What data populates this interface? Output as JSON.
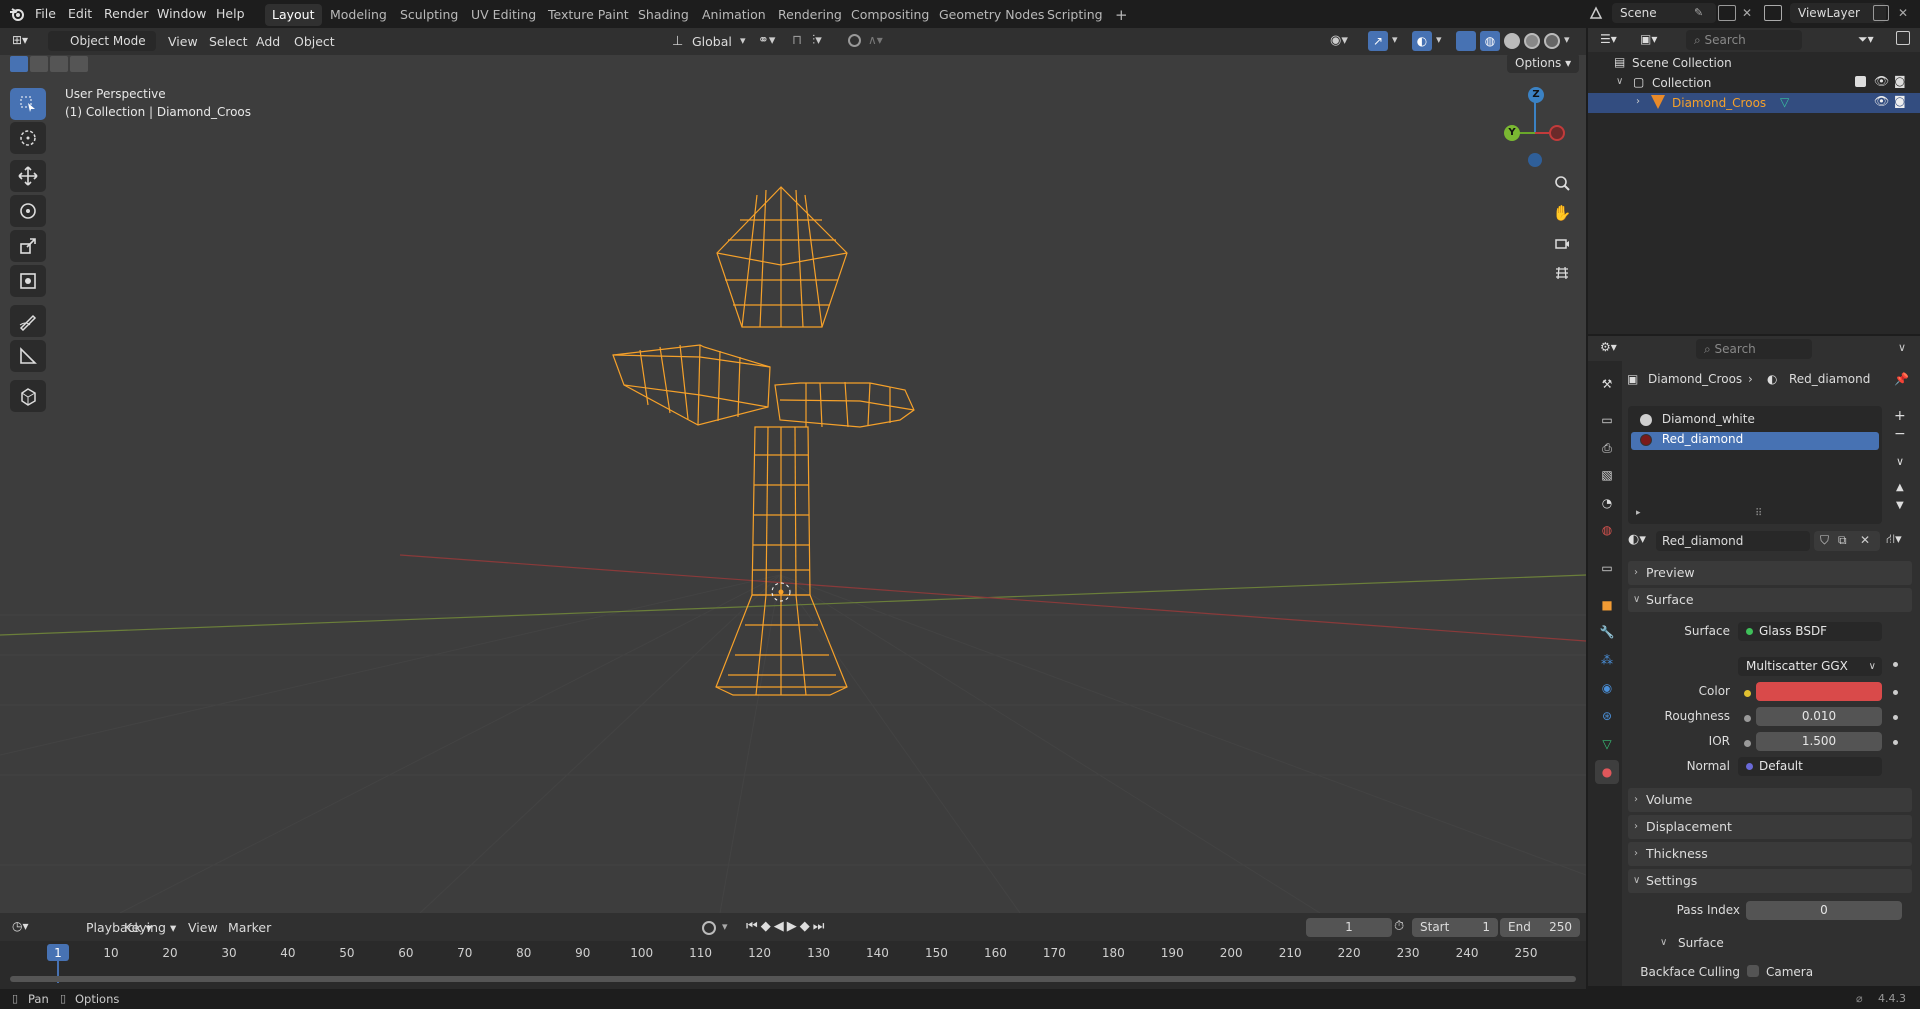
{
  "topbar": {
    "menus": [
      "File",
      "Edit",
      "Render",
      "Window",
      "Help"
    ],
    "workspaces": [
      "Layout",
      "Modeling",
      "Sculpting",
      "UV Editing",
      "Texture Paint",
      "Shading",
      "Animation",
      "Rendering",
      "Compositing",
      "Geometry Nodes",
      "Scripting"
    ],
    "active_workspace": "Layout",
    "scene_name": "Scene",
    "viewlayer_name": "ViewLayer"
  },
  "viewport_header": {
    "mode": "Object Mode",
    "menus": [
      "View",
      "Select",
      "Add",
      "Object"
    ],
    "orientation": "Global",
    "options_label": "Options"
  },
  "viewport": {
    "perspective": "User Perspective",
    "context": "(1) Collection | Diamond_Croos",
    "gizmo_axes": {
      "z": "Z",
      "y": "Y"
    },
    "wire_color": "#f6a12a",
    "bg_color": "#3d3d3d"
  },
  "outliner": {
    "search_placeholder": "Search",
    "root": "Scene Collection",
    "collection": "Collection",
    "object": "Diamond_Croos"
  },
  "properties": {
    "search_placeholder": "Search",
    "breadcrumb_object": "Diamond_Croos",
    "breadcrumb_material": "Red_diamond",
    "material_slots": [
      {
        "name": "Diamond_white",
        "color": "#cfcfcf"
      },
      {
        "name": "Red_diamond",
        "color": "#7a1a1a"
      }
    ],
    "active_slot": "Red_diamond",
    "material_name": "Red_diamond",
    "panels": {
      "preview": "Preview",
      "surface": "Surface",
      "volume": "Volume",
      "displacement": "Displacement",
      "thickness": "Thickness",
      "settings": "Settings",
      "settings_surface": "Surface"
    },
    "surface": {
      "surface_label": "Surface",
      "surface_value": "Glass BSDF",
      "distribution": "Multiscatter GGX",
      "color_label": "Color",
      "color_value": "#d94a4a",
      "roughness_label": "Roughness",
      "roughness_value": "0.010",
      "ior_label": "IOR",
      "ior_value": "1.500",
      "normal_label": "Normal",
      "normal_value": "Default"
    },
    "settings": {
      "pass_index_label": "Pass Index",
      "pass_index_value": "0",
      "backface_label": "Backface Culling",
      "camera_label": "Camera"
    }
  },
  "timeline": {
    "menus": [
      "Playback",
      "Keying",
      "View",
      "Marker"
    ],
    "current_frame": "1",
    "start_label": "Start",
    "start_value": "1",
    "end_label": "End",
    "end_value": "250",
    "ticks": [
      "1",
      "10",
      "20",
      "30",
      "40",
      "50",
      "60",
      "70",
      "80",
      "90",
      "100",
      "110",
      "120",
      "130",
      "140",
      "150",
      "160",
      "170",
      "180",
      "190",
      "200",
      "210",
      "220",
      "230",
      "240",
      "250"
    ]
  },
  "statusbar": {
    "left1": "Pan",
    "left2": "Options",
    "version": "4.4.3"
  }
}
